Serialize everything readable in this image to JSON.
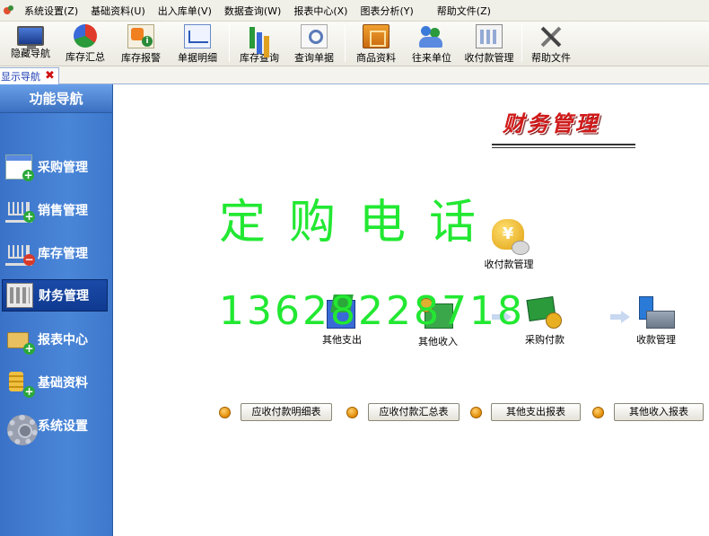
{
  "menubar": {
    "items": [
      "系统设置(Z)",
      "基础资料(U)",
      "出入库单(V)",
      "数据查询(W)",
      "报表中心(X)",
      "图表分析(Y)",
      "帮助文件(Z)"
    ]
  },
  "toolbar": {
    "buttons": [
      {
        "label": "隐藏导航",
        "icon": "monitor-icon"
      },
      {
        "label": "库存汇总",
        "icon": "pie-chart-icon"
      },
      {
        "label": "库存报警",
        "icon": "alert-info-icon"
      },
      {
        "label": "单据明细",
        "icon": "line-chart-icon"
      },
      {
        "label": "库存查询",
        "icon": "bar-chart-icon"
      },
      {
        "label": "查询单据",
        "icon": "magnifier-icon"
      },
      {
        "label": "商品资料",
        "icon": "product-box-icon"
      },
      {
        "label": "往来单位",
        "icon": "people-icon"
      },
      {
        "label": "收付款管理",
        "icon": "calculator-icon"
      },
      {
        "label": "帮助文件",
        "icon": "tools-icon"
      }
    ]
  },
  "tab": {
    "label": "显示导航"
  },
  "sidebar": {
    "title": "功能导航",
    "items": [
      {
        "label": "采购管理",
        "active": false
      },
      {
        "label": "销售管理",
        "active": false
      },
      {
        "label": "库存管理",
        "active": false
      },
      {
        "label": "财务管理",
        "active": true
      },
      {
        "label": "报表中心",
        "active": false
      },
      {
        "label": "基础资料",
        "active": false
      },
      {
        "label": "系统设置",
        "active": false
      }
    ]
  },
  "main": {
    "section_title": "财务管理",
    "watermark": {
      "line1": "定购电话",
      "line2": "13628228718"
    },
    "flow": {
      "hub": "收付款管理",
      "nodes": [
        "其他支出",
        "其他收入",
        "采购付款",
        "收款管理"
      ]
    },
    "reports": [
      "应收付款明细表",
      "应收付款汇总表",
      "其他支出报表",
      "其他收入报表"
    ]
  },
  "colors": {
    "sidebar_blue": "#3a72c8",
    "title_red": "#d01a1a",
    "watermark_green": "#22e832",
    "tab_link_blue": "#1a3ab0"
  }
}
